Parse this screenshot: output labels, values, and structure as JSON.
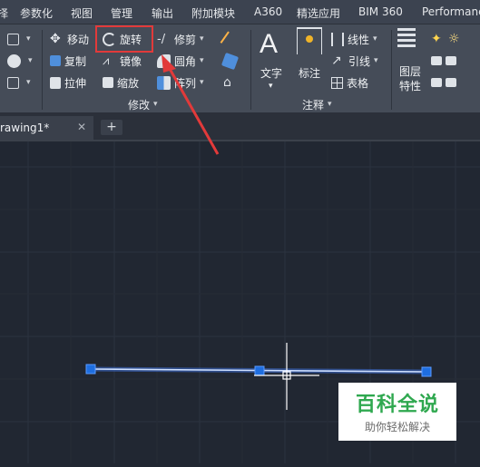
{
  "menu": [
    "择",
    "参数化",
    "视图",
    "管理",
    "输出",
    "附加模块",
    "A360",
    "精选应用",
    "BIM 360",
    "Performance"
  ],
  "modify": {
    "move": "移动",
    "rotate": "旋转",
    "trim": "修剪",
    "copy": "复制",
    "mirror": "镜像",
    "fillet": "圆角",
    "stretch": "拉伸",
    "scale": "缩放",
    "array": "阵列",
    "panel": "修改"
  },
  "annotation": {
    "big_letter": "A",
    "text": "文字",
    "dim": "标注",
    "linear": "线性",
    "leader": "引线",
    "table": "表格",
    "panel": "注释"
  },
  "layers": {
    "label": "图层\n特性",
    "label1": "图层",
    "label2": "特性"
  },
  "tabs": {
    "drawing": "rawing1*",
    "close": "✕",
    "new": "+"
  },
  "watermark": {
    "title": "百科全说",
    "subtitle": "助你轻松解决"
  },
  "colors": {
    "highlight": "#e23a3a",
    "line": "#6fa2ff",
    "grip": "#1e6ee0",
    "accent": "#2fa84f"
  }
}
